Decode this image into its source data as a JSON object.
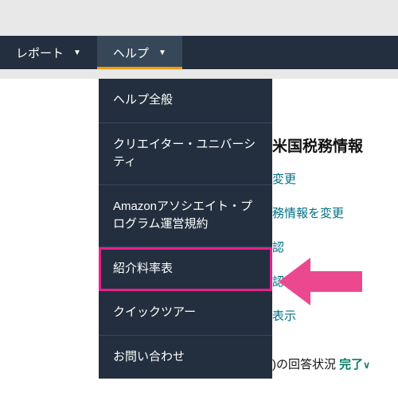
{
  "nav": {
    "report": "レポート",
    "help": "ヘルプ"
  },
  "dropdown": {
    "items": [
      "ヘルプ全般",
      "クリエイター・ユニバーシティ",
      "Amazonアソシエイト・プログラム運営規約",
      "紹介料率表",
      "クイックツアー",
      "お問い合わせ"
    ]
  },
  "bg": {
    "heading": "米国税務情報",
    "link1": "変更",
    "link2": "務情報を変更",
    "link3": "認",
    "link4": "認",
    "link5": "表示",
    "statusPrefix": ")の回答状況",
    "statusDone": "完了"
  }
}
